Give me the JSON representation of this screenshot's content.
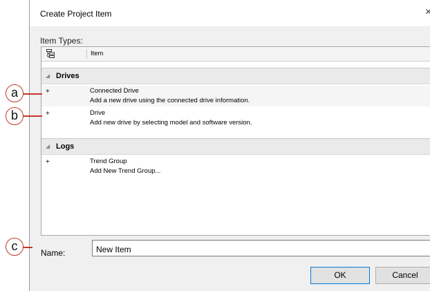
{
  "dialog": {
    "title": "Create Project Item",
    "close_glyph": "×",
    "item_types_label": "Item  Types:",
    "column_header": "Item",
    "groups": [
      {
        "label": "Drives",
        "items": [
          {
            "name": "Connected Drive",
            "description": "Add a new drive using the connected drive information."
          },
          {
            "name": "Drive",
            "description": "Add new drive by selecting model and software version."
          }
        ]
      },
      {
        "label": "Logs",
        "items": [
          {
            "name": "Trend Group",
            "description": "Add New Trend Group..."
          }
        ]
      }
    ],
    "name_label": "Name:",
    "name_value": "New Item",
    "ok_label": "OK",
    "cancel_label": "Cancel"
  },
  "callouts": {
    "a": "a",
    "b": "b",
    "c": "c"
  },
  "icons": {
    "collapse": "◢",
    "expand_item": "+"
  },
  "colors": {
    "callout": "#c0392b",
    "focus_border": "#0078d7"
  }
}
